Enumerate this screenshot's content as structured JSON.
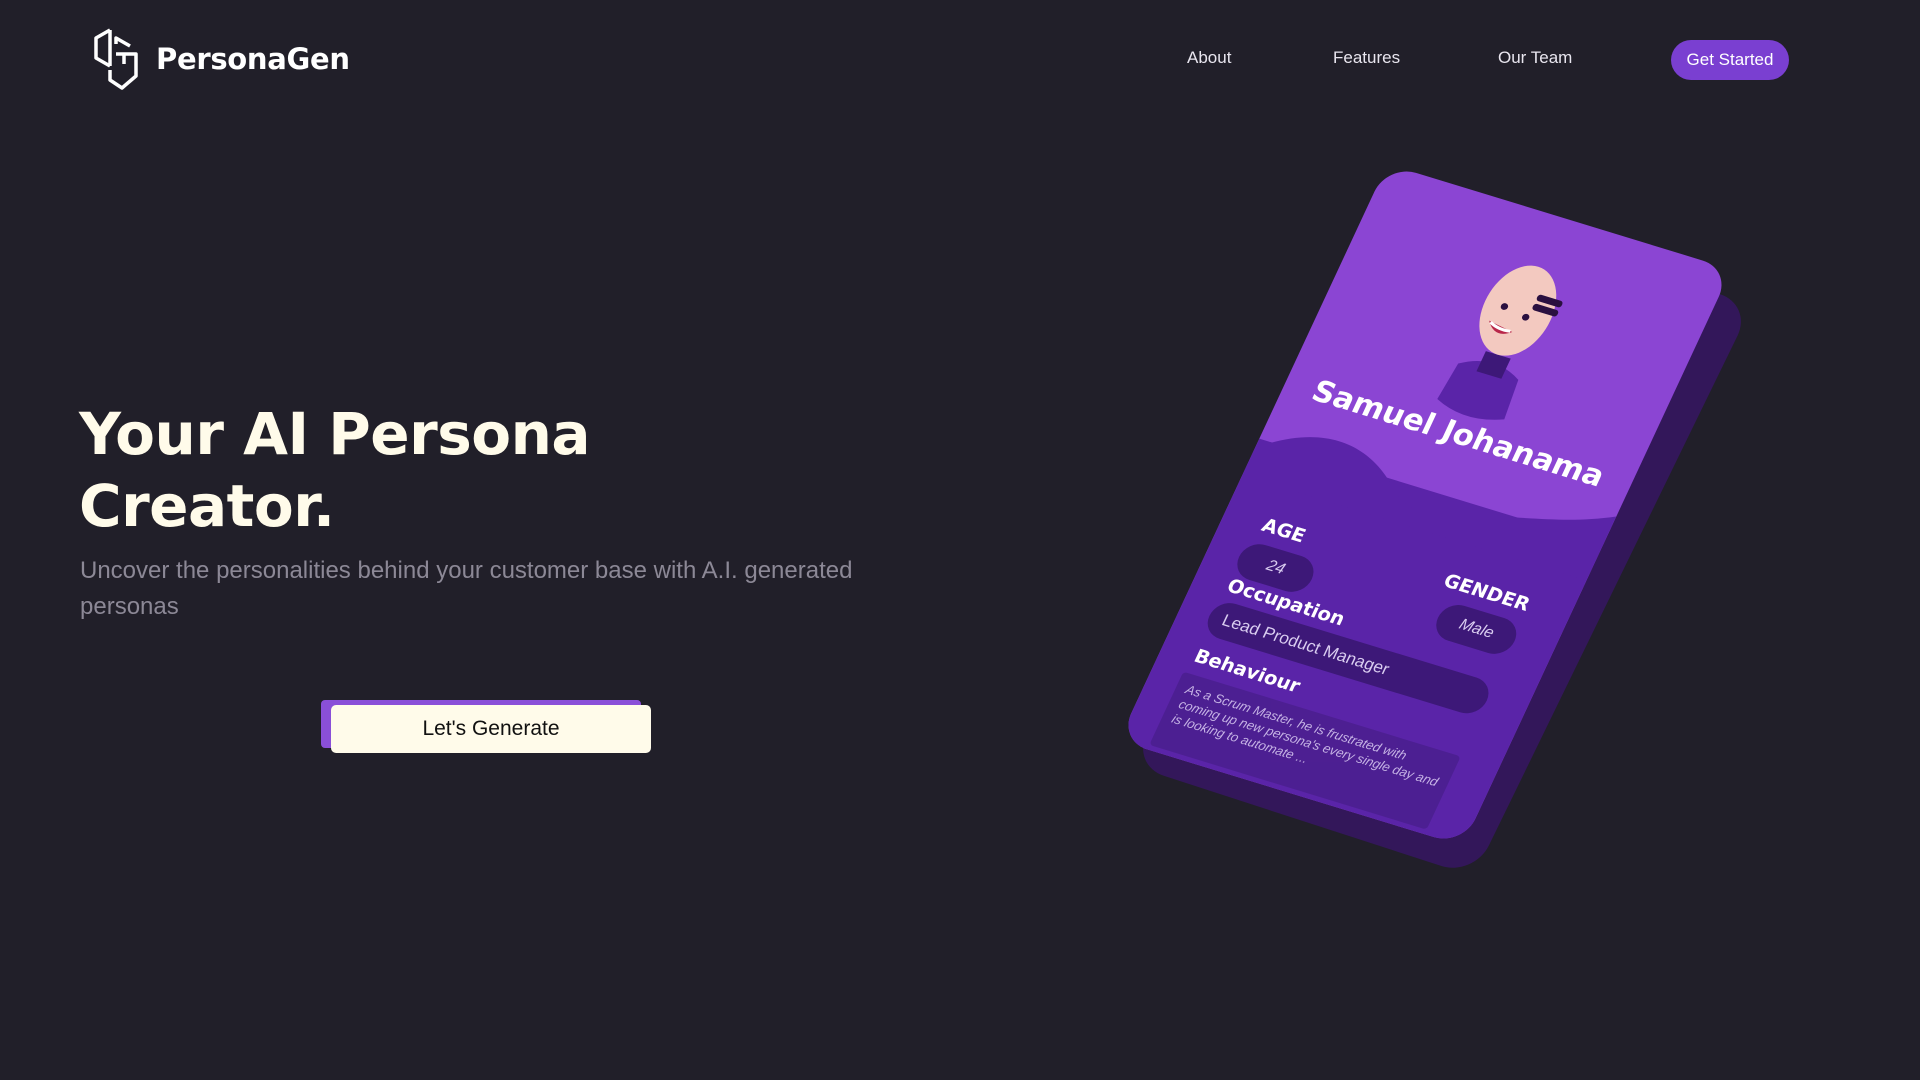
{
  "brand": {
    "name": "PersonaGen",
    "logo_icon": "hexagon-pg-logo-icon"
  },
  "nav": {
    "items": [
      {
        "label": "About"
      },
      {
        "label": "Features"
      },
      {
        "label": "Our Team"
      }
    ],
    "cta_label": "Get Started"
  },
  "hero": {
    "title_line1": "Your AI Persona",
    "title_line2": "Creator.",
    "subtitle": "Uncover the personalities behind your customer base with A.I. generated personas",
    "button_label": "Let's Generate"
  },
  "persona_card": {
    "name": "Samuel Johanama",
    "age_label": "AGE",
    "age_value": "24",
    "gender_label": "GENDER",
    "gender_value": "Male",
    "occupation_label": "Occupation",
    "occupation_value": "Lead Product Manager",
    "behaviour_label": "Behaviour",
    "behaviour_text": "As a Scrum Master, he is frustrated with coming up new persona's every single day and is looking to automate ..."
  },
  "colors": {
    "background": "#211f29",
    "accent": "#7a3fd1",
    "card_top": "#8b45d3",
    "card_bottom": "#5a24a8",
    "cream": "#fffbea",
    "subtitle": "#8c8896"
  }
}
